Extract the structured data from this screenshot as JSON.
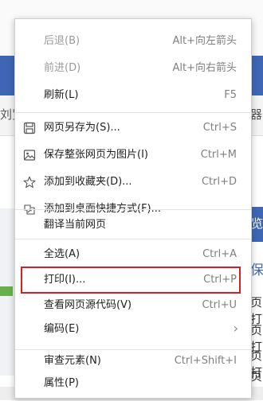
{
  "background": {
    "tab_left_text": "刘览",
    "tab_right_text": "器",
    "right_badge_text": "览",
    "right_texts": [
      "保",
      "页打",
      "页打",
      "页打",
      "页打"
    ]
  },
  "menu": {
    "back": {
      "label": "后退(B)",
      "shortcut": "Alt+向左箭头",
      "disabled": true
    },
    "forward": {
      "label": "前进(D)",
      "shortcut": "Alt+向右箭头",
      "disabled": true
    },
    "refresh": {
      "label": "刷新(L)",
      "shortcut": "F5"
    },
    "save_as": {
      "label": "网页另存为(S)...",
      "shortcut": "Ctrl+S",
      "icon": "save-icon"
    },
    "save_image": {
      "label": "保存整张网页为图片(I)",
      "shortcut": "Ctrl+M",
      "icon": "image-icon"
    },
    "favorite": {
      "label": "添加到收藏夹(D)...",
      "shortcut": "Ctrl+D",
      "icon": "star-icon"
    },
    "shortcut_desktop": {
      "label": "添加到桌面快捷方式(F)...",
      "icon": "desktop-shortcut-icon"
    },
    "translate": {
      "label": "翻译当前网页"
    },
    "select_all": {
      "label": "全选(A)",
      "shortcut": "Ctrl+A"
    },
    "print": {
      "label": "打印(I)...",
      "shortcut": "Ctrl+P",
      "highlighted": true,
      "highlight_color": "#d21f2b"
    },
    "view_source": {
      "label": "查看网页源代码(V)",
      "shortcut": "Ctrl+U"
    },
    "encoding": {
      "label": "编码(E)",
      "submenu_icon": "chevron-right-icon"
    },
    "inspect": {
      "label": "审查元素(N)",
      "shortcut": "Ctrl+Shift+I"
    },
    "properties": {
      "label": "属性(P)"
    }
  }
}
